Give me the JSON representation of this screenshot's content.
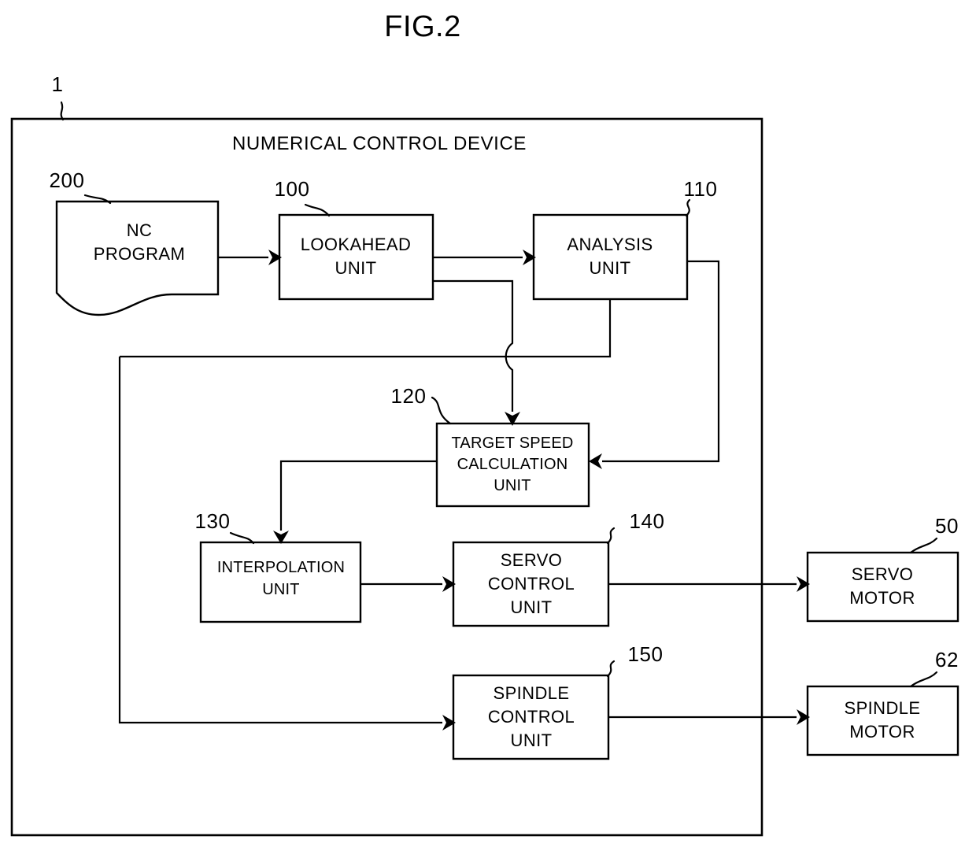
{
  "figure": {
    "title": "FIG.2",
    "device_label": "NUMERICAL CONTROL DEVICE",
    "device_ref": "1"
  },
  "nodes": {
    "nc_program": {
      "ref": "200",
      "line1": "NC",
      "line2": "PROGRAM",
      "shape": "document"
    },
    "lookahead_unit": {
      "ref": "100",
      "line1": "LOOKAHEAD",
      "line2": "UNIT",
      "shape": "rect"
    },
    "analysis_unit": {
      "ref": "110",
      "line1": "ANALYSIS",
      "line2": "UNIT",
      "shape": "rect"
    },
    "target_speed_unit": {
      "ref": "120",
      "line1": "TARGET SPEED",
      "line2": "CALCULATION",
      "line3": "UNIT",
      "shape": "rect"
    },
    "interpolation_unit": {
      "ref": "130",
      "line1": "INTERPOLATION",
      "line2": "UNIT",
      "shape": "rect"
    },
    "servo_control_unit": {
      "ref": "140",
      "line1": "SERVO",
      "line2": "CONTROL",
      "line3": "UNIT",
      "shape": "rect"
    },
    "spindle_control_unit": {
      "ref": "150",
      "line1": "SPINDLE",
      "line2": "CONTROL",
      "line3": "UNIT",
      "shape": "rect"
    },
    "servo_motor": {
      "ref": "50",
      "line1": "SERVO",
      "line2": "MOTOR",
      "shape": "rect"
    },
    "spindle_motor": {
      "ref": "62",
      "line1": "SPINDLE",
      "line2": "MOTOR",
      "shape": "rect"
    }
  },
  "colors": {
    "stroke": "#000000",
    "background": "#ffffff"
  }
}
